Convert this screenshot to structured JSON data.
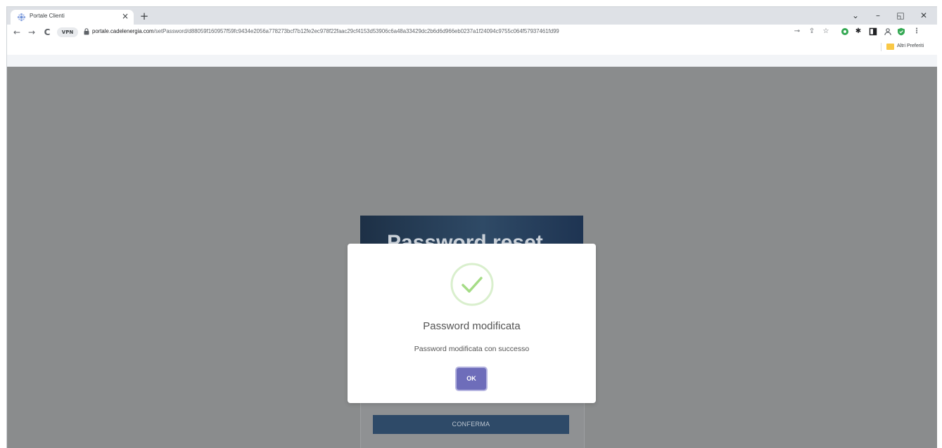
{
  "browser": {
    "tab_title": "Portale Clienti",
    "tab_close": "×",
    "new_tab": "+",
    "window_controls": {
      "dropdown": "⌄",
      "minimize": "–",
      "restore": "◱",
      "close": "✕"
    },
    "nav": {
      "back": "←",
      "forward": "→",
      "reload": "C"
    },
    "vpn_label": "VPN",
    "url_host": "portale.cadelenergia.com",
    "url_path": "/setPassword/d88059f160957f59fc9434e2056a778273bcf7b12fe2ec978f22faac29cf4153d53906c6a48a33429dc2b6d6d966eb0237a1f24094c9755c064f57937461fd99",
    "bookmark_label": "Altri Preferiti",
    "extension_icons": [
      "key-icon",
      "share-icon",
      "star-icon",
      "shield-icon",
      "puzzle-icon",
      "sidebar-icon",
      "profile-icon",
      "shield-check-icon",
      "menu-icon"
    ]
  },
  "page": {
    "hero_title": "Password reset",
    "confirm_label": "CONFERMA"
  },
  "modal": {
    "title": "Password modificata",
    "message": "Password modificata con successo",
    "ok_label": "OK",
    "icon": "check-circle-icon",
    "accent_color": "#6e6dba",
    "success_color": "#a5dc86"
  }
}
